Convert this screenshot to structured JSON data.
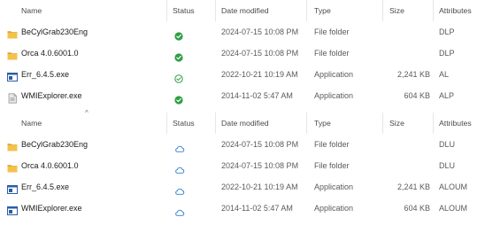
{
  "columns": {
    "name": "Name",
    "status": "Status",
    "date": "Date modified",
    "type": "Type",
    "size": "Size",
    "attributes": "Attributes"
  },
  "top_pane": {
    "rows": [
      {
        "name": "BeCylGrab230Eng",
        "icon": "folder-icon",
        "status_icon": "synced-filled-icon",
        "date": "2024-07-15 10:08 PM",
        "type": "File folder",
        "size": "",
        "attributes": "DLP"
      },
      {
        "name": "Orca 4.0.6001.0",
        "icon": "folder-icon",
        "status_icon": "synced-filled-icon",
        "date": "2024-07-15 10:08 PM",
        "type": "File folder",
        "size": "",
        "attributes": "DLP"
      },
      {
        "name": "Err_6.4.5.exe",
        "icon": "exe-window-icon",
        "status_icon": "available-outline-icon",
        "date": "2022-10-21 10:19 AM",
        "type": "Application",
        "size": "2,241 KB",
        "attributes": "AL"
      },
      {
        "name": "WMIExplorer.exe",
        "icon": "exe-generic-icon",
        "status_icon": "synced-filled-icon",
        "date": "2014-11-02 5:47 AM",
        "type": "Application",
        "size": "604 KB",
        "attributes": "ALP"
      }
    ]
  },
  "bottom_pane": {
    "rows": [
      {
        "name": "BeCylGrab230Eng",
        "icon": "folder-icon",
        "status_icon": "cloud-icon",
        "date": "2024-07-15 10:08 PM",
        "type": "File folder",
        "size": "",
        "attributes": "DLU"
      },
      {
        "name": "Orca 4.0.6001.0",
        "icon": "folder-icon",
        "status_icon": "cloud-icon",
        "date": "2024-07-15 10:08 PM",
        "type": "File folder",
        "size": "",
        "attributes": "DLU"
      },
      {
        "name": "Err_6.4.5.exe",
        "icon": "exe-window-icon",
        "status_icon": "cloud-icon",
        "date": "2022-10-21 10:19 AM",
        "type": "Application",
        "size": "2,241 KB",
        "attributes": "ALOUM"
      },
      {
        "name": "WMIExplorer.exe",
        "icon": "exe-window-icon",
        "status_icon": "cloud-icon",
        "date": "2014-11-02 5:47 AM",
        "type": "Application",
        "size": "604 KB",
        "attributes": "ALOUM"
      }
    ]
  },
  "colors": {
    "folder": "#f3c24a",
    "folder_dark": "#dca52c",
    "synced_green": "#2e9e45",
    "cloud_blue": "#2f7fcf",
    "exe_blue": "#2a5ea8"
  }
}
